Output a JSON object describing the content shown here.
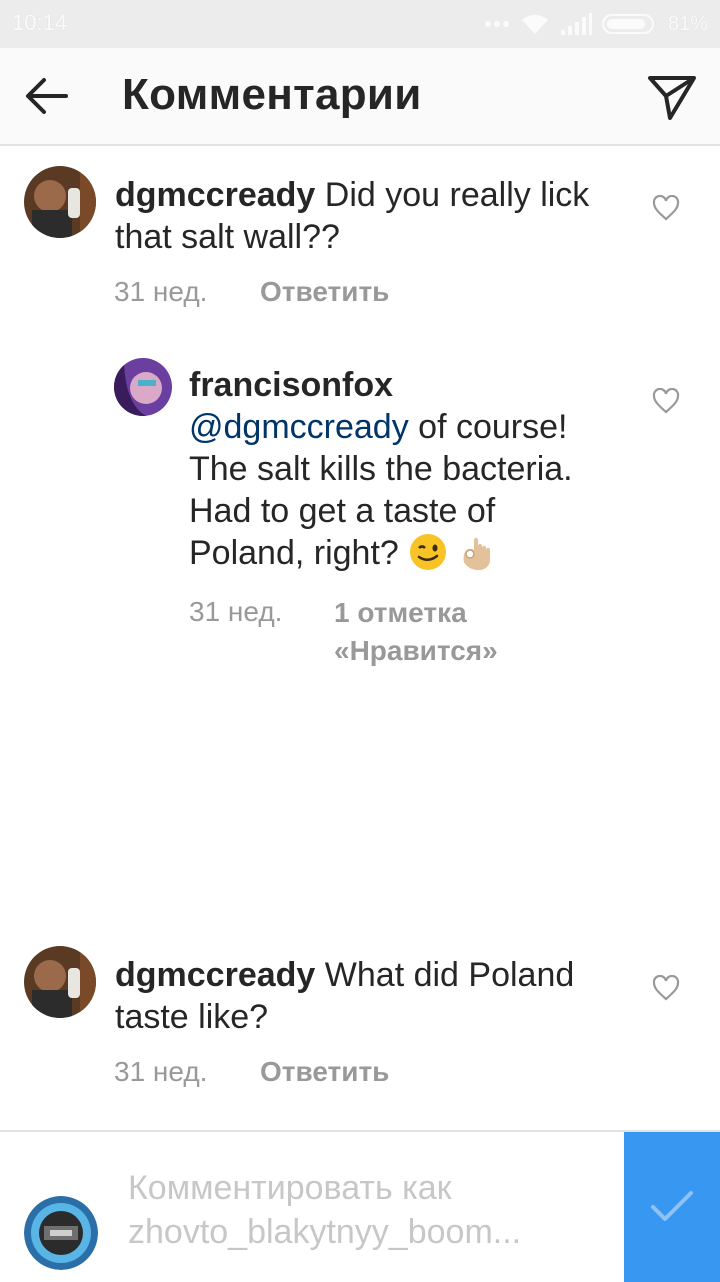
{
  "status_bar": {
    "time": "10:14",
    "battery": "81%"
  },
  "header": {
    "title": "Комментарии"
  },
  "comments": [
    {
      "username": "dgmccready",
      "text": "Did you really lick",
      "text_line2": "that salt wall??",
      "age": "31 нед.",
      "reply_label": "Ответить"
    },
    {
      "username": "francisonfox",
      "mention": "@dgmccready",
      "text_after_mention": " of course!",
      "line2": "The salt kills the bacteria.",
      "line3": "Had to get a taste of",
      "line4": "Poland, right?",
      "age": "31 нед.",
      "likes_line1": "1 отметка",
      "likes_line2": "«Нравится»"
    },
    {
      "username": "dgmccready",
      "text": "What did Poland",
      "text_line2": "taste like?",
      "age": "31 нед.",
      "reply_label": "Ответить"
    }
  ],
  "compose": {
    "placeholder_line1": "Комментировать как",
    "placeholder_line2": "zhovto_blakytnyy_boom..."
  },
  "colors": {
    "accent": "#3897f0",
    "mention": "#003569",
    "muted": "#999999"
  }
}
